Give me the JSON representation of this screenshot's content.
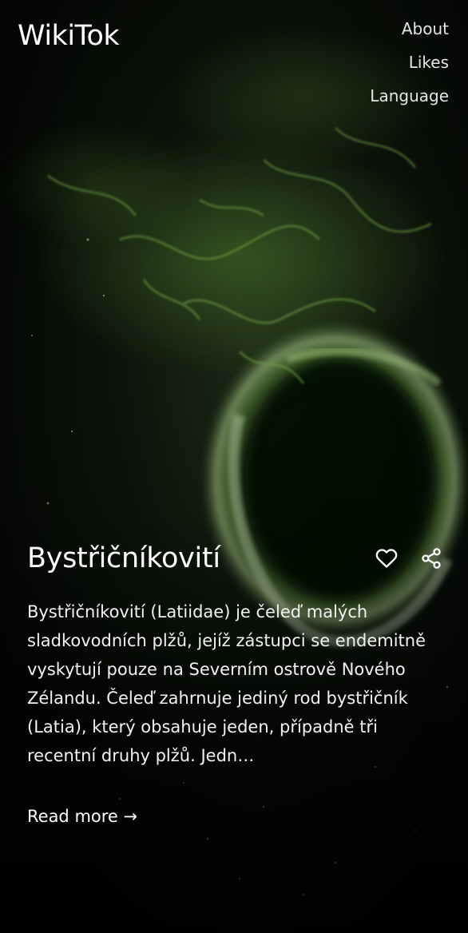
{
  "app": {
    "logo": "WikiTok"
  },
  "nav": {
    "about": "About",
    "likes": "Likes",
    "language": "Language"
  },
  "article": {
    "title": "Bystřičníkovití",
    "summary": "Bystřičníkovití (Latiidae) je čeleď malých sladkovodních plžů, jejíž zástupci se endemitně vyskytují pouze na Severním ostrově Nového Zélandu. Čeleď zahrnuje jediný rod bystřičník (Latia), který obsahuje jeden, případně tři recentní druhy plžů. Jedn…",
    "read_more": "Read more →"
  },
  "icons": {
    "like": "heart-icon",
    "share": "share-icon"
  },
  "colors": {
    "background": "#040504",
    "glow_green": "#7fbf4a",
    "text": "#ffffff"
  }
}
